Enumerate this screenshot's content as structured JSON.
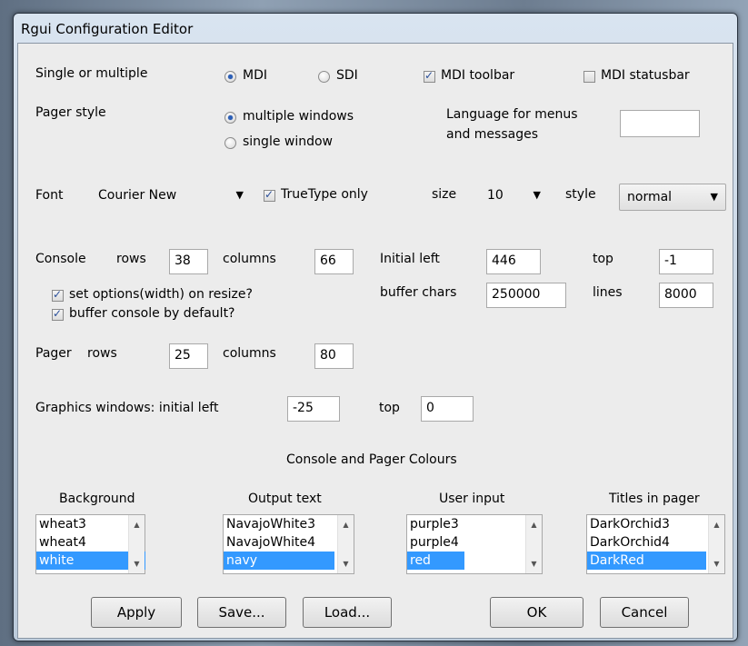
{
  "window": {
    "title": "Rgui Configuration Editor"
  },
  "mode": {
    "label": "Single or multiple",
    "mdi_label": "MDI",
    "mdi_selected": true,
    "sdi_label": "SDI",
    "sdi_selected": false,
    "toolbar_label": "MDI toolbar",
    "toolbar_checked": true,
    "statusbar_label": "MDI statusbar",
    "statusbar_checked": false
  },
  "pager_style": {
    "label": "Pager style",
    "multiple_label": "multiple windows",
    "multiple_selected": true,
    "single_label": "single window",
    "single_selected": false
  },
  "language": {
    "label_line1": "Language for menus",
    "label_line2": "and messages",
    "value": ""
  },
  "font": {
    "label": "Font",
    "family": "Courier New",
    "truetype_label": "TrueType only",
    "truetype_checked": true,
    "size_label": "size",
    "size_value": "10",
    "style_label": "style",
    "style_value": "normal"
  },
  "console": {
    "label": "Console",
    "rows_label": "rows",
    "rows": "38",
    "columns_label": "columns",
    "columns": "66",
    "initial_left_label": "Initial left",
    "initial_left": "446",
    "top_label": "top",
    "top": "-1",
    "buffer_chars_label": "buffer chars",
    "buffer_chars": "250000",
    "lines_label": "lines",
    "lines": "8000",
    "setwidth_label": "set options(width) on resize?",
    "setwidth_checked": true,
    "buffer_label": "buffer console by default?",
    "buffer_checked": true
  },
  "pager": {
    "label": "Pager",
    "rows_label": "rows",
    "rows": "25",
    "columns_label": "columns",
    "columns": "80"
  },
  "graphics": {
    "label": "Graphics windows: initial left",
    "left": "-25",
    "top_label": "top",
    "top": "0"
  },
  "colours": {
    "heading": "Console and Pager Colours",
    "lists": [
      {
        "title": "Background",
        "items": [
          "wheat3",
          "wheat4",
          "white"
        ],
        "selected": "white"
      },
      {
        "title": "Output text",
        "items": [
          "NavajoWhite3",
          "NavajoWhite4",
          "navy"
        ],
        "selected": "navy"
      },
      {
        "title": "User input",
        "items": [
          "purple3",
          "purple4",
          "red"
        ],
        "selected": "red"
      },
      {
        "title": "Titles in pager",
        "items": [
          "DarkOrchid3",
          "DarkOrchid4",
          "DarkRed"
        ],
        "selected": "DarkRed"
      }
    ]
  },
  "buttons": {
    "apply": "Apply",
    "save": "Save...",
    "load": "Load...",
    "ok": "OK",
    "cancel": "Cancel"
  },
  "icons": {
    "dropdown": "chevron-down-icon",
    "scroll_up": "scroll-up-icon",
    "scroll_down": "scroll-down-icon"
  },
  "colors": {
    "selection": "#3399ff",
    "radio_dot": "#2b5fb8",
    "client_bg": "#ececec"
  }
}
